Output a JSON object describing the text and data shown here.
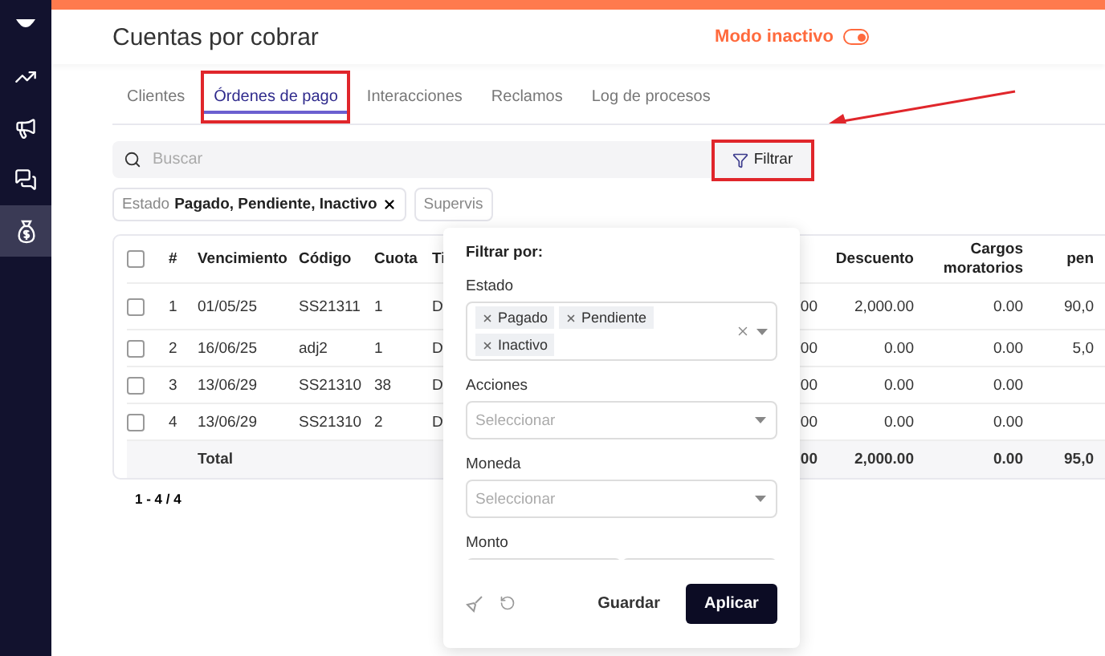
{
  "sidebar": {
    "items": [
      {
        "selected": false
      },
      {
        "selected": false
      },
      {
        "selected": false
      },
      {
        "selected": false
      },
      {
        "selected": true
      }
    ]
  },
  "header": {
    "title": "Cuentas por cobrar",
    "mode_label": "Modo inactivo",
    "mode_on": true
  },
  "tabs": [
    {
      "label": "Clientes",
      "selected": false,
      "highlighted": false
    },
    {
      "label": "Órdenes de pago",
      "selected": true,
      "highlighted": true
    },
    {
      "label": "Interacciones",
      "selected": false,
      "highlighted": false
    },
    {
      "label": "Reclamos",
      "selected": false,
      "highlighted": false
    },
    {
      "label": "Log de procesos",
      "selected": false,
      "highlighted": false
    }
  ],
  "search": {
    "placeholder": "Buscar"
  },
  "filter_button": {
    "label": "Filtrar",
    "highlighted": true
  },
  "annotation_arrow": true,
  "active_filters": [
    {
      "name": "Estado",
      "value": "Pagado, Pendiente, Inactivo",
      "removable": true
    },
    {
      "name": "Supervis",
      "removable": false
    }
  ],
  "table": {
    "header_checked": false,
    "columns": [
      "#",
      "Vencimiento",
      "Código",
      "Cuota",
      "Ti"
    ],
    "columns_right": [
      "Descuento",
      "Cargos moratorios",
      "pen"
    ],
    "rows": [
      {
        "checked": false,
        "cells": [
          "1",
          "01/05/25",
          "SS21311",
          "1",
          "D",
          "00",
          "2,000.00",
          "0.00",
          "90,0"
        ]
      },
      {
        "checked": false,
        "cells": [
          "2",
          "16/06/25",
          "adj2",
          "1",
          "D",
          "00",
          "0.00",
          "0.00",
          "5,0"
        ]
      },
      {
        "checked": false,
        "cells": [
          "3",
          "13/06/29",
          "SS21310",
          "38",
          "D",
          "00",
          "0.00",
          "0.00",
          ""
        ]
      },
      {
        "checked": false,
        "cells": [
          "4",
          "13/06/29",
          "SS21310",
          "2",
          "D",
          "00",
          "0.00",
          "0.00",
          ""
        ]
      }
    ],
    "total": {
      "label": "Total",
      "cells": [
        "00",
        "2,000.00",
        "0.00",
        "95,0"
      ]
    }
  },
  "pagination": "1 - 4 / 4",
  "filter_panel": {
    "title": "Filtrar por:",
    "fields": [
      {
        "kind": "multiselect",
        "label": "Estado",
        "tags": [
          "Pagado",
          "Pendiente",
          "Inactivo"
        ]
      },
      {
        "kind": "select",
        "label": "Acciones",
        "placeholder": "Seleccionar"
      },
      {
        "kind": "select",
        "label": "Moneda",
        "placeholder": "Seleccionar"
      },
      {
        "kind": "range",
        "label": "Monto"
      }
    ],
    "save_label": "Guardar",
    "apply_label": "Aplicar"
  }
}
